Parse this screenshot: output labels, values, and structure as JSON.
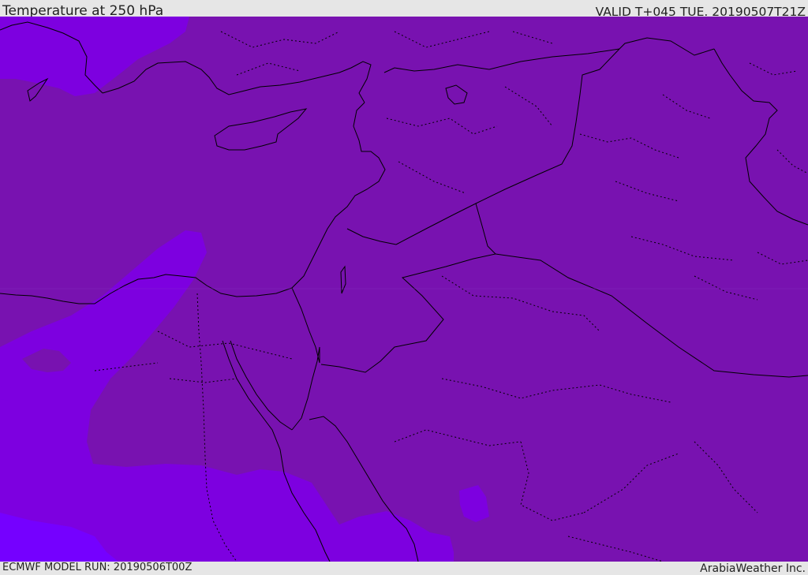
{
  "header": {
    "title": "Temperature at 250 hPa",
    "valid": "VALID T+045 TUE. 20190507T21Z"
  },
  "footer": {
    "model_run": "ECMWF MODEL RUN: 20190506T00Z",
    "credit": "ArabiaWeather Inc."
  },
  "map": {
    "variable": "temperature",
    "pressure_level_hpa": 250,
    "colors": {
      "base_fill": "#7812b0",
      "cooler_band": "#7d00e0",
      "coolest_band": "#7500ff",
      "coastline": "#000000",
      "borders": "#000000"
    }
  }
}
